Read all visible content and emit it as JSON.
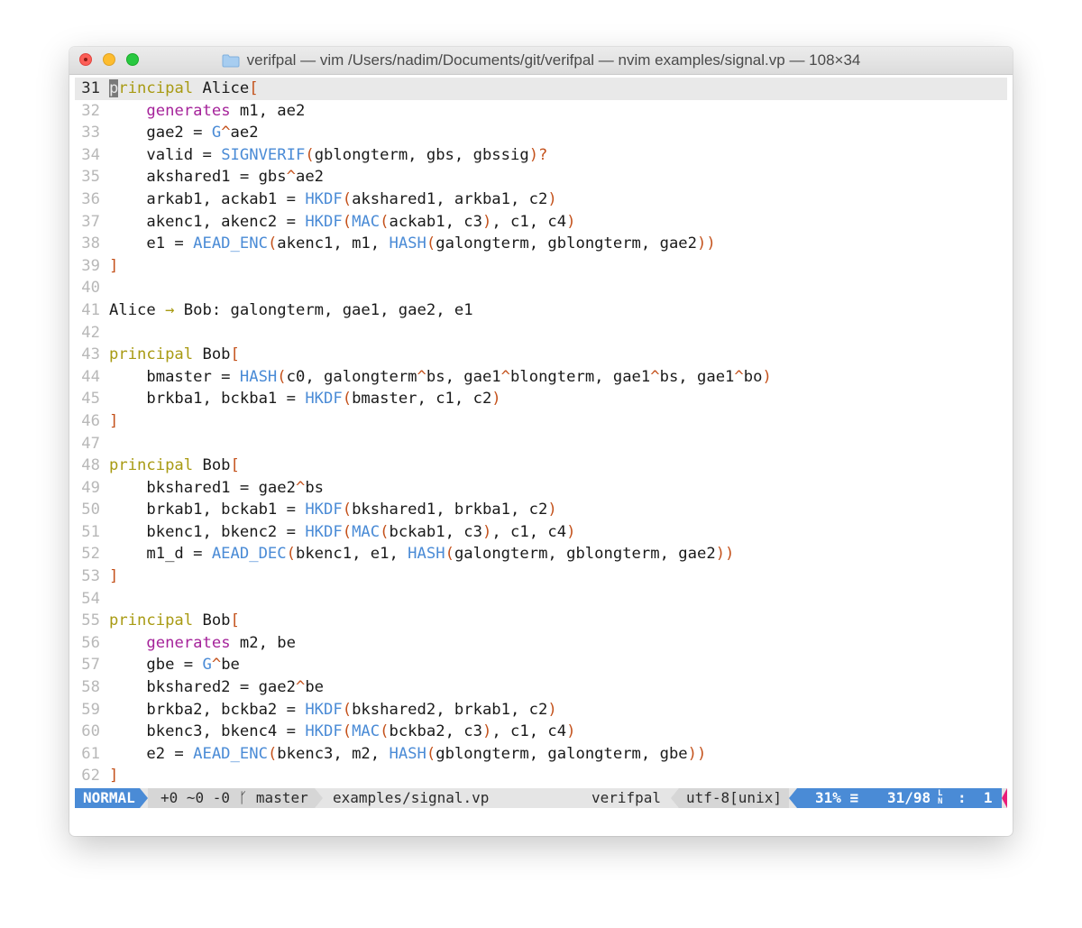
{
  "window": {
    "title": "verifpal — vim /Users/nadim/Documents/git/verifpal — nvim examples/signal.vp — 108×34"
  },
  "colors": {
    "keyword": "#a89a12",
    "generates": "#a5239a",
    "function": "#4a8bd6",
    "bracket": "#c4521c",
    "mode_bg": "#4a8bd6",
    "warning": "#e91e7a"
  },
  "editor": {
    "lines": [
      {
        "num": "31",
        "current": true,
        "tokens": [
          [
            "cursor",
            "p"
          ],
          [
            "kw",
            "rincipal"
          ],
          [
            "t",
            " Alice"
          ],
          [
            "br",
            "["
          ]
        ]
      },
      {
        "num": "32",
        "tokens": [
          [
            "t",
            "    "
          ],
          [
            "gen",
            "generates"
          ],
          [
            "t",
            " m1, ae2"
          ]
        ]
      },
      {
        "num": "33",
        "tokens": [
          [
            "t",
            "    gae2 = "
          ],
          [
            "fn",
            "G"
          ],
          [
            "op",
            "^"
          ],
          [
            "t",
            "ae2"
          ]
        ]
      },
      {
        "num": "34",
        "tokens": [
          [
            "t",
            "    valid = "
          ],
          [
            "fn",
            "SIGNVERIF"
          ],
          [
            "br",
            "("
          ],
          [
            "t",
            "gblongterm, gbs, gbssig"
          ],
          [
            "br",
            ")?"
          ]
        ]
      },
      {
        "num": "35",
        "tokens": [
          [
            "t",
            "    akshared1 = gbs"
          ],
          [
            "op",
            "^"
          ],
          [
            "t",
            "ae2"
          ]
        ]
      },
      {
        "num": "36",
        "tokens": [
          [
            "t",
            "    arkab1, ackab1 = "
          ],
          [
            "fn",
            "HKDF"
          ],
          [
            "br",
            "("
          ],
          [
            "t",
            "akshared1, arkba1, c2"
          ],
          [
            "br",
            ")"
          ]
        ]
      },
      {
        "num": "37",
        "tokens": [
          [
            "t",
            "    akenc1, akenc2 = "
          ],
          [
            "fn",
            "HKDF"
          ],
          [
            "br",
            "("
          ],
          [
            "fn",
            "MAC"
          ],
          [
            "br",
            "("
          ],
          [
            "t",
            "ackab1, c3"
          ],
          [
            "br",
            ")"
          ],
          [
            "t",
            ", c1, c4"
          ],
          [
            "br",
            ")"
          ]
        ]
      },
      {
        "num": "38",
        "tokens": [
          [
            "t",
            "    e1 = "
          ],
          [
            "fn",
            "AEAD_ENC"
          ],
          [
            "br",
            "("
          ],
          [
            "t",
            "akenc1, m1, "
          ],
          [
            "fn",
            "HASH"
          ],
          [
            "br",
            "("
          ],
          [
            "t",
            "galongterm, gblongterm, gae2"
          ],
          [
            "br",
            "))"
          ]
        ]
      },
      {
        "num": "39",
        "tokens": [
          [
            "br",
            "]"
          ]
        ]
      },
      {
        "num": "40",
        "tokens": []
      },
      {
        "num": "41",
        "tokens": [
          [
            "t",
            "Alice "
          ],
          [
            "ar",
            "→"
          ],
          [
            "t",
            " Bob: galongterm, gae1, gae2, e1"
          ]
        ]
      },
      {
        "num": "42",
        "tokens": []
      },
      {
        "num": "43",
        "tokens": [
          [
            "kw",
            "principal"
          ],
          [
            "t",
            " Bob"
          ],
          [
            "br",
            "["
          ]
        ]
      },
      {
        "num": "44",
        "tokens": [
          [
            "t",
            "    bmaster = "
          ],
          [
            "fn",
            "HASH"
          ],
          [
            "br",
            "("
          ],
          [
            "t",
            "c0, galongterm"
          ],
          [
            "op",
            "^"
          ],
          [
            "t",
            "bs, gae1"
          ],
          [
            "op",
            "^"
          ],
          [
            "t",
            "blongterm, gae1"
          ],
          [
            "op",
            "^"
          ],
          [
            "t",
            "bs, gae1"
          ],
          [
            "op",
            "^"
          ],
          [
            "t",
            "bo"
          ],
          [
            "br",
            ")"
          ]
        ]
      },
      {
        "num": "45",
        "tokens": [
          [
            "t",
            "    brkba1, bckba1 = "
          ],
          [
            "fn",
            "HKDF"
          ],
          [
            "br",
            "("
          ],
          [
            "t",
            "bmaster, c1, c2"
          ],
          [
            "br",
            ")"
          ]
        ]
      },
      {
        "num": "46",
        "tokens": [
          [
            "br",
            "]"
          ]
        ]
      },
      {
        "num": "47",
        "tokens": []
      },
      {
        "num": "48",
        "tokens": [
          [
            "kw",
            "principal"
          ],
          [
            "t",
            " Bob"
          ],
          [
            "br",
            "["
          ]
        ]
      },
      {
        "num": "49",
        "tokens": [
          [
            "t",
            "    bkshared1 = gae2"
          ],
          [
            "op",
            "^"
          ],
          [
            "t",
            "bs"
          ]
        ]
      },
      {
        "num": "50",
        "tokens": [
          [
            "t",
            "    brkab1, bckab1 = "
          ],
          [
            "fn",
            "HKDF"
          ],
          [
            "br",
            "("
          ],
          [
            "t",
            "bkshared1, brkba1, c2"
          ],
          [
            "br",
            ")"
          ]
        ]
      },
      {
        "num": "51",
        "tokens": [
          [
            "t",
            "    bkenc1, bkenc2 = "
          ],
          [
            "fn",
            "HKDF"
          ],
          [
            "br",
            "("
          ],
          [
            "fn",
            "MAC"
          ],
          [
            "br",
            "("
          ],
          [
            "t",
            "bckab1, c3"
          ],
          [
            "br",
            ")"
          ],
          [
            "t",
            ", c1, c4"
          ],
          [
            "br",
            ")"
          ]
        ]
      },
      {
        "num": "52",
        "tokens": [
          [
            "t",
            "    m1_d = "
          ],
          [
            "fn",
            "AEAD_DEC"
          ],
          [
            "br",
            "("
          ],
          [
            "t",
            "bkenc1, e1, "
          ],
          [
            "fn",
            "HASH"
          ],
          [
            "br",
            "("
          ],
          [
            "t",
            "galongterm, gblongterm, gae2"
          ],
          [
            "br",
            "))"
          ]
        ]
      },
      {
        "num": "53",
        "tokens": [
          [
            "br",
            "]"
          ]
        ]
      },
      {
        "num": "54",
        "tokens": []
      },
      {
        "num": "55",
        "tokens": [
          [
            "kw",
            "principal"
          ],
          [
            "t",
            " Bob"
          ],
          [
            "br",
            "["
          ]
        ]
      },
      {
        "num": "56",
        "tokens": [
          [
            "t",
            "    "
          ],
          [
            "gen",
            "generates"
          ],
          [
            "t",
            " m2, be"
          ]
        ]
      },
      {
        "num": "57",
        "tokens": [
          [
            "t",
            "    gbe = "
          ],
          [
            "fn",
            "G"
          ],
          [
            "op",
            "^"
          ],
          [
            "t",
            "be"
          ]
        ]
      },
      {
        "num": "58",
        "tokens": [
          [
            "t",
            "    bkshared2 = gae2"
          ],
          [
            "op",
            "^"
          ],
          [
            "t",
            "be"
          ]
        ]
      },
      {
        "num": "59",
        "tokens": [
          [
            "t",
            "    brkba2, bckba2 = "
          ],
          [
            "fn",
            "HKDF"
          ],
          [
            "br",
            "("
          ],
          [
            "t",
            "bkshared2, brkab1, c2"
          ],
          [
            "br",
            ")"
          ]
        ]
      },
      {
        "num": "60",
        "tokens": [
          [
            "t",
            "    bkenc3, bkenc4 = "
          ],
          [
            "fn",
            "HKDF"
          ],
          [
            "br",
            "("
          ],
          [
            "fn",
            "MAC"
          ],
          [
            "br",
            "("
          ],
          [
            "t",
            "bckba2, c3"
          ],
          [
            "br",
            ")"
          ],
          [
            "t",
            ", c1, c4"
          ],
          [
            "br",
            ")"
          ]
        ]
      },
      {
        "num": "61",
        "tokens": [
          [
            "t",
            "    e2 = "
          ],
          [
            "fn",
            "AEAD_ENC"
          ],
          [
            "br",
            "("
          ],
          [
            "t",
            "bkenc3, m2, "
          ],
          [
            "fn",
            "HASH"
          ],
          [
            "br",
            "("
          ],
          [
            "t",
            "gblongterm, galongterm, gbe"
          ],
          [
            "br",
            "))"
          ]
        ]
      },
      {
        "num": "62",
        "tokens": [
          [
            "br",
            "]"
          ]
        ]
      }
    ]
  },
  "statusline": {
    "mode": "NORMAL",
    "git": "+0 ~0 -0 ᚴ master",
    "file": "examples/signal.vp",
    "project": "verifpal",
    "encoding": "utf-8[unix]",
    "percent": "31% ≡",
    "line_pos": "31/98",
    "ln_icon": "LN",
    "col_sep": ":",
    "col": "1"
  }
}
